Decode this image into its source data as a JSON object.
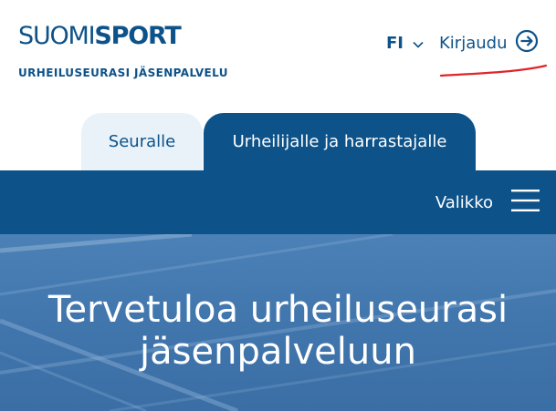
{
  "brand": {
    "logo_thin": "SUOMI",
    "logo_bold": "SPORT",
    "tagline": "URHEILUSEURASI JÄSENPALVELU",
    "color": "#0d5289"
  },
  "header": {
    "language": {
      "code": "FI",
      "icon": "chevron-down-icon"
    },
    "login": {
      "label": "Kirjaudu",
      "icon": "login-arrow-icon"
    },
    "annotation_color": "#e0242a"
  },
  "tabs": [
    {
      "label": "Seuralle",
      "active": false
    },
    {
      "label": "Urheilijalle ja harrastajalle",
      "active": true
    }
  ],
  "navbar": {
    "menu_label": "Valikko",
    "menu_icon": "hamburger-icon"
  },
  "hero": {
    "title_line1": "Tervetuloa urheiluseurasi",
    "title_line2": "jäsenpalveluun"
  }
}
